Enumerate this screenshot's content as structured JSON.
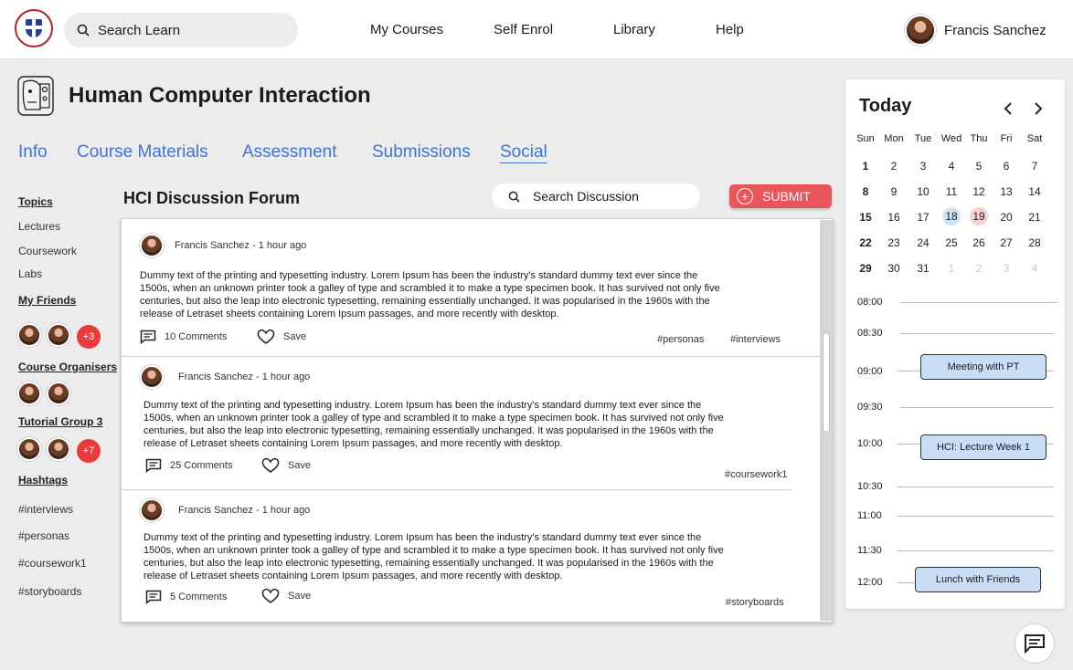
{
  "header": {
    "search_placeholder": "Search Learn",
    "nav": [
      "My Courses",
      "Self Enrol",
      "Library",
      "Help"
    ],
    "user_name": "Francis Sanchez"
  },
  "course": {
    "title": "Human Computer Interaction",
    "tabs": [
      "Info",
      "Course Materials",
      "Assessment",
      "Submissions",
      "Social"
    ],
    "active_tab": "Social"
  },
  "sidebar": {
    "topics_label": "Topics",
    "topics": [
      "Lectures",
      "Coursework",
      "Labs"
    ],
    "friends_label": "My Friends",
    "friends_extra": "+3",
    "organisers_label": "Course Organisers",
    "tutorial_label": "Tutorial Group 3",
    "tutorial_extra": "+7",
    "hashtags_label": "Hashtags",
    "hashtags": [
      "#interviews",
      "#personas",
      "#coursework1",
      "#storyboards"
    ]
  },
  "forum": {
    "title": "HCI Discussion Forum",
    "search_placeholder": "Search Discussion",
    "submit_label": "SUBMIT",
    "save_label": "Save",
    "posts": [
      {
        "meta": "Francis Sanchez - 1 hour ago",
        "lines": [
          "Dummy text of the printing and typesetting industry. Lorem Ipsum has been the industry's standard dummy text ever since the",
          "1500s, when an unknown printer took a galley of type and scrambled it to make a type specimen book. It has survived not only five",
          "centuries, but also the leap into electronic typesetting, remaining essentially unchanged. It was popularised in the 1960s with the",
          "release of Letraset sheets containing Lorem Ipsum passages, and more recently with desktop."
        ],
        "comments": "10 Comments",
        "tags": [
          "#personas",
          "#interviews"
        ]
      },
      {
        "meta": "Francis Sanchez - 1 hour ago",
        "lines": [
          "Dummy text of the printing and typesetting industry. Lorem Ipsum has been the industry's standard dummy text ever since the",
          "1500s, when an unknown printer took a galley of type and scrambled it to make a type specimen book. It has survived not only five",
          "centuries, but also the leap into electronic typesetting, remaining essentially unchanged. It was popularised in the 1960s with the",
          "release of Letraset sheets containing Lorem Ipsum passages, and more recently with desktop."
        ],
        "comments": "25 Comments",
        "tags": [
          "#coursework1"
        ]
      },
      {
        "meta": "Francis Sanchez - 1 hour ago",
        "lines": [
          "Dummy text of the printing and typesetting industry. Lorem Ipsum has been the industry's standard dummy text ever since the",
          "1500s, when an unknown printer took a galley of type and scrambled it to make a type specimen book. It has survived not only five",
          "centuries, but also the leap into electronic typesetting, remaining essentially unchanged. It was popularised in the 1960s with the",
          "release of Letraset sheets containing Lorem Ipsum passages, and more recently with desktop."
        ],
        "comments": "5 Comments",
        "tags": [
          "#storyboards"
        ]
      }
    ]
  },
  "calendar": {
    "title": "Today",
    "weekdays": [
      "Sun",
      "Mon",
      "Tue",
      "Wed",
      "Thu",
      "Fri",
      "Sat"
    ],
    "weeks": [
      [
        "1",
        "2",
        "3",
        "4",
        "5",
        "6",
        "7"
      ],
      [
        "8",
        "9",
        "10",
        "11",
        "12",
        "13",
        "14"
      ],
      [
        "15",
        "16",
        "17",
        "18",
        "19",
        "20",
        "21"
      ],
      [
        "22",
        "23",
        "24",
        "25",
        "26",
        "27",
        "28"
      ],
      [
        "29",
        "30",
        "31",
        "1",
        "2",
        "3",
        "4"
      ]
    ],
    "highlight_blue": "18",
    "highlight_red": "19",
    "times": [
      "08:00",
      "08:30",
      "09:00",
      "09:30",
      "10:00",
      "10:30",
      "11:00",
      "11:30",
      "12:00"
    ],
    "events": [
      "Meeting with PT",
      "HCI: Lecture Week 1",
      "Lunch with Friends"
    ],
    "colors": {
      "event_fill": "#c9def6",
      "blue_day": "#cfe3f7",
      "red_day": "#f7d1d1"
    }
  }
}
